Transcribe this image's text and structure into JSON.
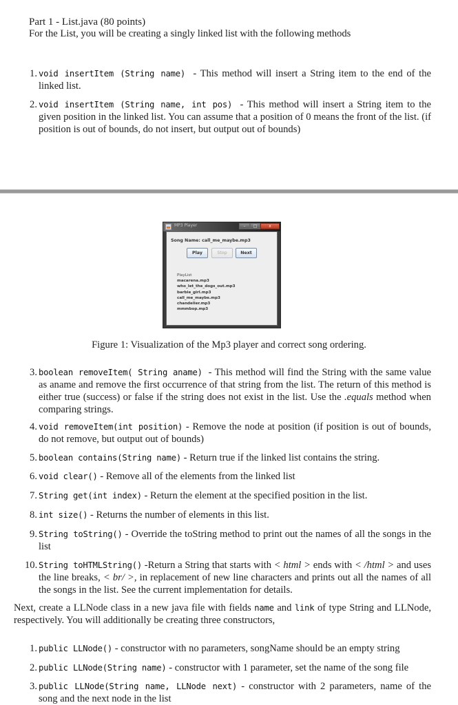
{
  "header": {
    "title": "Part 1 - List.java (80 points)",
    "intro": "For the List, you will be creating a singly linked list with the following methods"
  },
  "methods_part1": [
    {
      "num": "1.",
      "signature": "void insertItem (String name)",
      "description": "- This method will insert a String item to the end of the linked list."
    },
    {
      "num": "2.",
      "signature": "void insertItem (String name, int pos)",
      "description": "- This method will insert a String item to the given position in the linked list. You can assume that a position of 0 means the front of the list. (if position is out of bounds, do not insert, but output out of bounds)"
    }
  ],
  "figure": {
    "window_title": "MP3 Player",
    "window_buttons": {
      "minimize": "–",
      "maximize": "□",
      "close": "x"
    },
    "song_name_label": "Song Name: call_me_maybe.mp3",
    "buttons": {
      "play": "Play",
      "stop": "Stop",
      "next": "Next"
    },
    "stop_enabled": false,
    "playlist_header": "PlayList",
    "playlist": [
      "macarena.mp3",
      "who_let_the_dogs_out.mp3",
      "barbie_girl.mp3",
      "call_me_maybe.mp3",
      "chandelier.mp3",
      "mmmbop.mp3"
    ],
    "caption": "Figure 1: Visualization of the Mp3 player and correct song ordering."
  },
  "methods_part2": [
    {
      "num": "3.",
      "signature": "boolean removeItem( String aname)",
      "description_before": "- This method will find the String with the same value as aname and remove the first occurrence of that string from the list. The return of this method is either true (success) or false if the string does not exist in the list. Use the",
      "emphasis": ".equals",
      "description_after": "method when comparing strings."
    },
    {
      "num": "4.",
      "signature": "void removeItem(int position)",
      "description": "- Remove the node at position (if position is out of bounds, do not remove, but output out of bounds)"
    },
    {
      "num": "5.",
      "signature": "boolean contains(String name)",
      "description": "- Return true if the linked list contains the string."
    },
    {
      "num": "6.",
      "signature": "void clear()",
      "description": "- Remove all of the elements from the linked list"
    },
    {
      "num": "7.",
      "signature": "String get(int index)",
      "description": "- Return the element at the specified position in the list."
    },
    {
      "num": "8.",
      "signature": "int size()",
      "description": "- Returns the number of elements in this list."
    },
    {
      "num": "9.",
      "signature": "String toString()",
      "description": "- Override the toString method to print out the names of all the songs in the list"
    },
    {
      "num": "10.",
      "signature": "String toHTMLString()",
      "description_a": "-Return a String that starts with",
      "html_open": "< html >",
      "description_b": "ends with",
      "html_close": "< /html >",
      "description_c": "and uses the line breaks,",
      "br_tag": "< br/ >",
      "description_d": ", in replacement of new line characters and prints out all the names of all the songs in the list. See the current implementation for details."
    }
  ],
  "llnode": {
    "intro_a": "Next, create a LLNode class in a new java file with fields",
    "field1": "name",
    "intro_b": "and",
    "field2": "link",
    "intro_c": "of type String and LLNode, respectively. You will additionally be creating three constructors,",
    "constructors": [
      {
        "num": "1.",
        "signature": "public LLNode()",
        "description": "- constructor with no parameters, songName should be an empty string"
      },
      {
        "num": "2.",
        "signature": "public LLNode(String name)",
        "description": "- constructor with 1 parameter, set the name of the song file"
      },
      {
        "num": "3.",
        "signature": "public LLNode(String name, LLNode next)",
        "description": "- constructor with 2 parameters, name of the song and the next node in the list"
      }
    ]
  }
}
